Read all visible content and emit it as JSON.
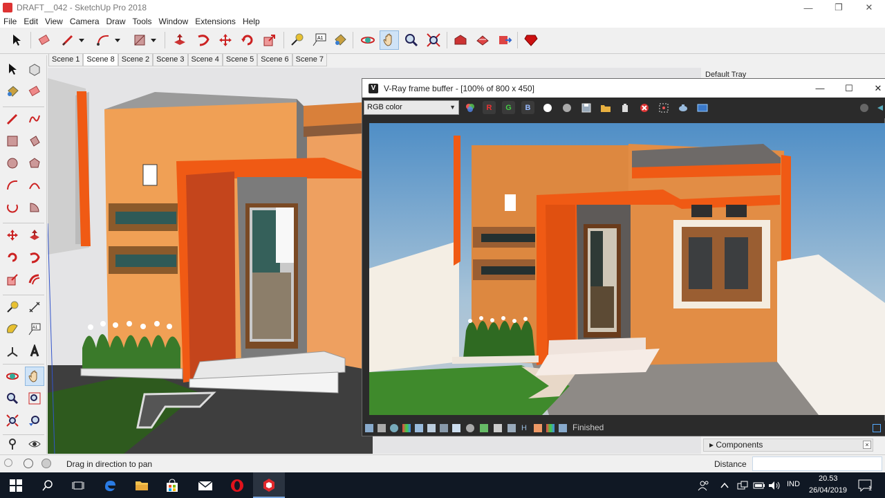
{
  "app": {
    "title": "DRAFT__042 - SketchUp Pro 2018"
  },
  "menu": [
    "File",
    "Edit",
    "View",
    "Camera",
    "Draw",
    "Tools",
    "Window",
    "Extensions",
    "Help"
  ],
  "scenes": {
    "items": [
      "Scene 1",
      "Scene 8",
      "Scene 2",
      "Scene 3",
      "Scene 4",
      "Scene 5",
      "Scene 6",
      "Scene 7"
    ],
    "active": "Scene 8"
  },
  "tray": {
    "title": "Default Tray"
  },
  "vfb": {
    "title": "V-Ray frame buffer - [100% of 800 x 450]",
    "channel": "RGB color",
    "r_label": "R",
    "g_label": "G",
    "b_label": "B",
    "status": "Finished"
  },
  "components": {
    "label": "Components",
    "close": "×"
  },
  "statusbar": {
    "hint": "Drag in direction to pan",
    "distance_label": "Distance",
    "distance_value": ""
  },
  "taskbar": {
    "language": "IND",
    "time": "20.53",
    "date": "26/04/2019",
    "notifications": "1"
  },
  "colors": {
    "accent_orange": "#f05a14",
    "wall_orange": "#f0a050",
    "taskbar": "#101824",
    "vfb_bg": "#2b2b2b"
  }
}
